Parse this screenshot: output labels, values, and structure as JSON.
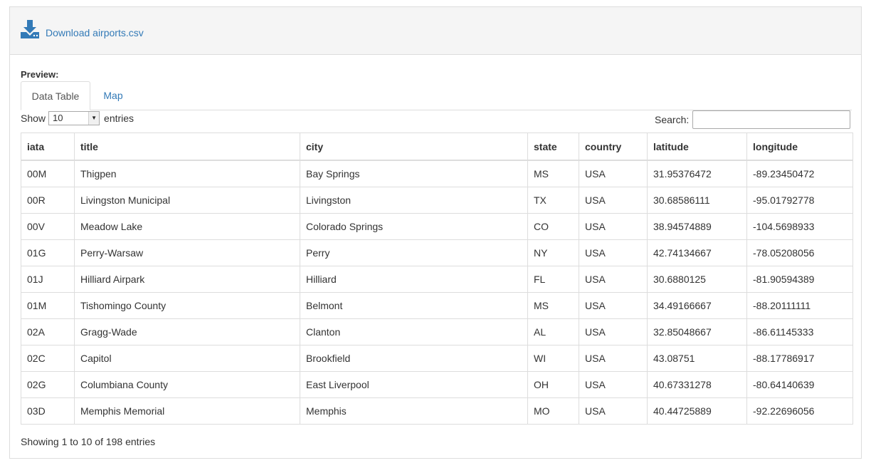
{
  "download": {
    "label": "Download airports.csv",
    "icon": "download-icon"
  },
  "preview_label": "Preview:",
  "tabs": [
    {
      "label": "Data Table",
      "active": true
    },
    {
      "label": "Map",
      "active": false
    }
  ],
  "length_control": {
    "prefix": "Show",
    "selected": "10",
    "suffix": "entries"
  },
  "search": {
    "label": "Search:",
    "value": ""
  },
  "table": {
    "columns": [
      "iata",
      "title",
      "city",
      "state",
      "country",
      "latitude",
      "longitude"
    ],
    "rows": [
      [
        "00M",
        "Thigpen",
        "Bay Springs",
        "MS",
        "USA",
        "31.95376472",
        "-89.23450472"
      ],
      [
        "00R",
        "Livingston Municipal",
        "Livingston",
        "TX",
        "USA",
        "30.68586111",
        "-95.01792778"
      ],
      [
        "00V",
        "Meadow Lake",
        "Colorado Springs",
        "CO",
        "USA",
        "38.94574889",
        "-104.5698933"
      ],
      [
        "01G",
        "Perry-Warsaw",
        "Perry",
        "NY",
        "USA",
        "42.74134667",
        "-78.05208056"
      ],
      [
        "01J",
        "Hilliard Airpark",
        "Hilliard",
        "FL",
        "USA",
        "30.6880125",
        "-81.90594389"
      ],
      [
        "01M",
        "Tishomingo County",
        "Belmont",
        "MS",
        "USA",
        "34.49166667",
        "-88.20111111"
      ],
      [
        "02A",
        "Gragg-Wade",
        "Clanton",
        "AL",
        "USA",
        "32.85048667",
        "-86.61145333"
      ],
      [
        "02C",
        "Capitol",
        "Brookfield",
        "WI",
        "USA",
        "43.08751",
        "-88.17786917"
      ],
      [
        "02G",
        "Columbiana County",
        "East Liverpool",
        "OH",
        "USA",
        "40.67331278",
        "-80.64140639"
      ],
      [
        "03D",
        "Memphis Memorial",
        "Memphis",
        "MO",
        "USA",
        "40.44725889",
        "-92.22696056"
      ]
    ]
  },
  "info": "Showing 1 to 10 of 198 entries",
  "colors": {
    "link": "#337ab7",
    "border": "#dddddd",
    "heading_bg": "#f5f5f5"
  }
}
